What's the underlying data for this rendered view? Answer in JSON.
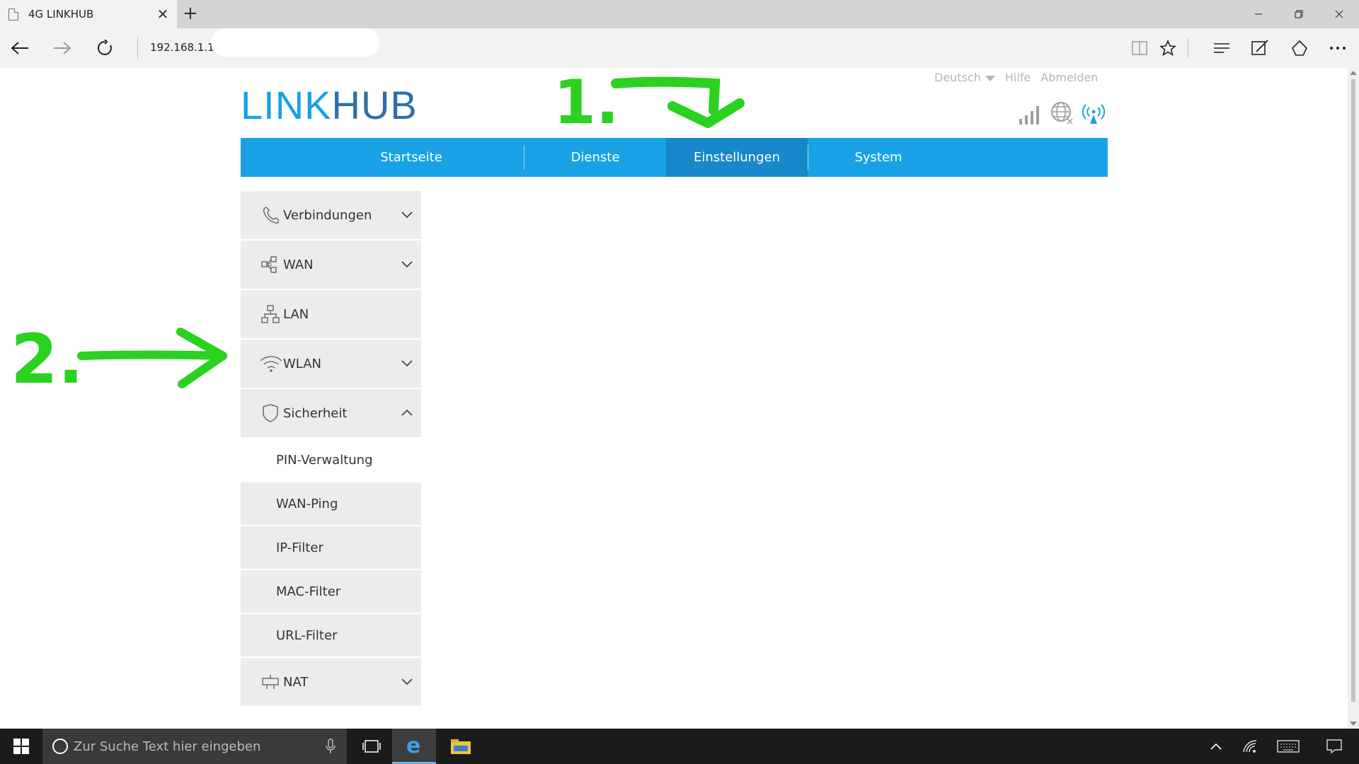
{
  "browser": {
    "tab_title": "4G LINKHUB",
    "address": "192.168.1.1/",
    "new_tab": "+",
    "close_tab": "✕"
  },
  "page": {
    "logo_part1": "LINK",
    "logo_part2": "HUB",
    "toplinks": {
      "language": "Deutsch",
      "help": "Hilfe",
      "logout": "Abmelden"
    },
    "mainnav": [
      {
        "label": "Startseite"
      },
      {
        "label": "Dienste"
      },
      {
        "label": "Einstellungen",
        "active": true
      },
      {
        "label": "System"
      }
    ],
    "sidebar": {
      "items": [
        {
          "label": "Verbindungen",
          "icon": "phone-icon",
          "expanded": false
        },
        {
          "label": "WAN",
          "icon": "wan-icon",
          "expanded": false
        },
        {
          "label": "LAN",
          "icon": "lan-icon"
        },
        {
          "label": "WLAN",
          "icon": "wifi-icon",
          "expanded": false
        },
        {
          "label": "Sicherheit",
          "icon": "shield-icon",
          "expanded": true
        },
        {
          "label": "NAT",
          "icon": "nat-icon",
          "expanded": false
        }
      ],
      "security_sub": [
        "PIN-Verwaltung",
        "WAN-Ping",
        "IP-Filter",
        "MAC-Filter",
        "URL-Filter"
      ]
    },
    "annotations": {
      "one": "1.",
      "two": "2."
    },
    "accent_color": "#1aa2e6",
    "annotation_color": "#2bd11f"
  },
  "taskbar": {
    "search_placeholder": "Zur Suche Text hier eingeben"
  }
}
